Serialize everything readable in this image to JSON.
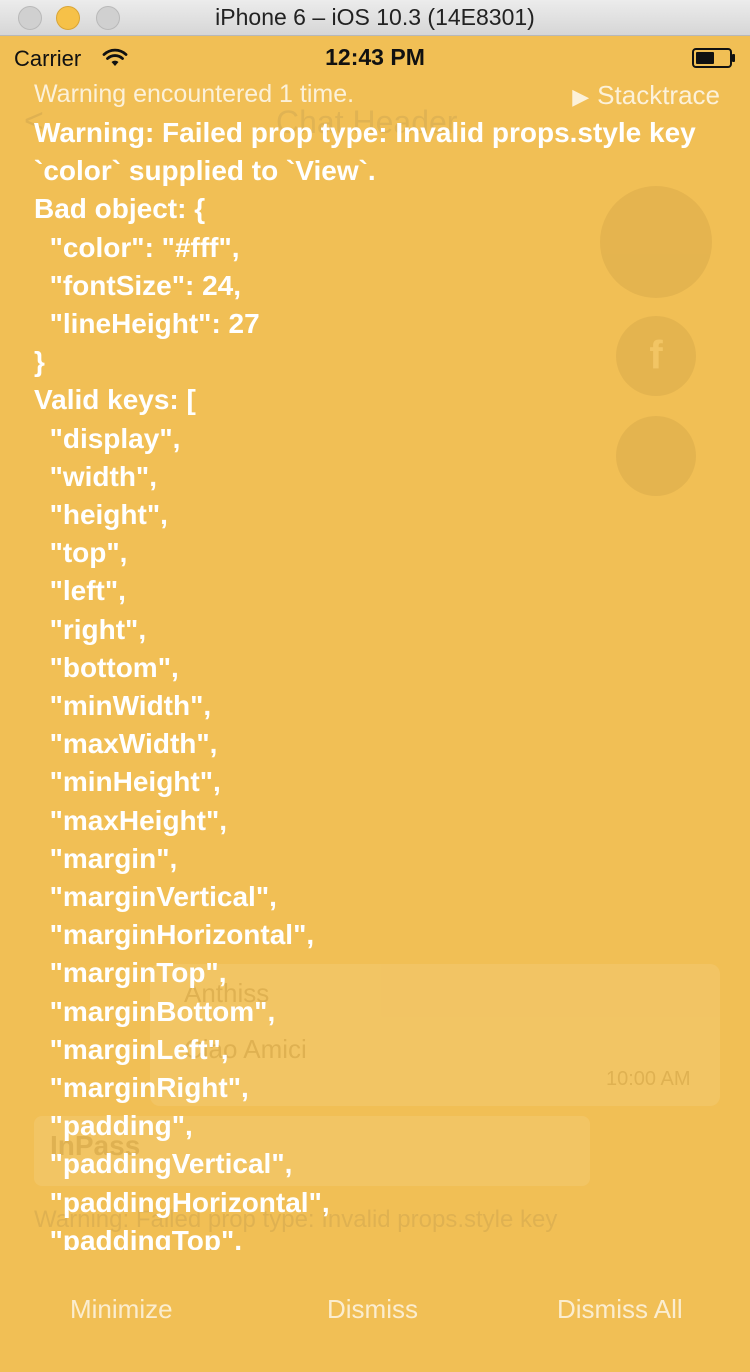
{
  "window": {
    "title": "iPhone 6 – iOS 10.3 (14E8301)"
  },
  "statusbar": {
    "carrier": "Carrier",
    "time": "12:43 PM"
  },
  "background_app": {
    "back_glyph": "<",
    "header_title": "Chat Header",
    "fab_facebook": "f",
    "card_title": "Anthiss",
    "card_subtitle": "Ciao Amici",
    "card_time": "10:00 AM",
    "card2_title": "InPass",
    "card2_subtitle": "Warning: Failed prop type: Invalid props.style key"
  },
  "warning": {
    "count_text": "Warning encountered 1 time.",
    "stacktrace_label": "Stacktrace",
    "message": "Warning: Failed prop type: Invalid props.style key `color` supplied to `View`.\nBad object: {\n  \"color\": \"#fff\",\n  \"fontSize\": 24,\n  \"lineHeight\": 27\n}\nValid keys: [\n  \"display\",\n  \"width\",\n  \"height\",\n  \"top\",\n  \"left\",\n  \"right\",\n  \"bottom\",\n  \"minWidth\",\n  \"maxWidth\",\n  \"minHeight\",\n  \"maxHeight\",\n  \"margin\",\n  \"marginVertical\",\n  \"marginHorizontal\",\n  \"marginTop\",\n  \"marginBottom\",\n  \"marginLeft\",\n  \"marginRight\",\n  \"padding\",\n  \"paddingVertical\",\n  \"paddingHorizontal\",\n  \"paddingTop\","
  },
  "actions": {
    "minimize": "Minimize",
    "dismiss": "Dismiss",
    "dismiss_all": "Dismiss All"
  },
  "colors": {
    "overlay": "#f1bf55",
    "text": "#ffffff"
  }
}
